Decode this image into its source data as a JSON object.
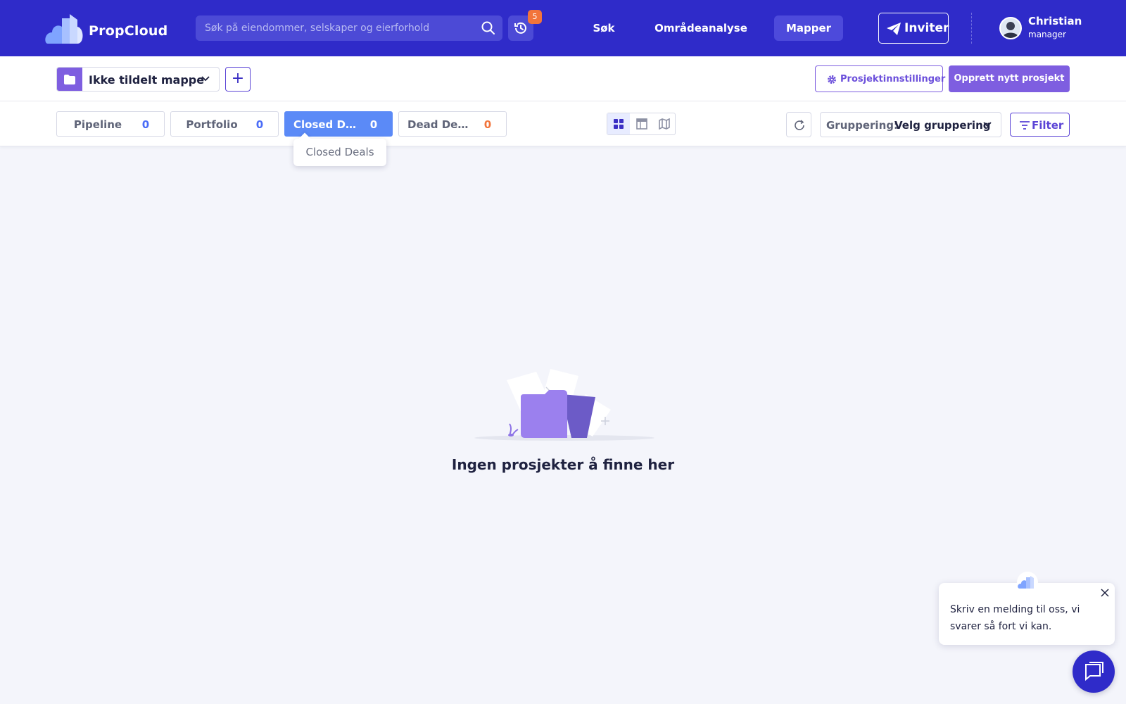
{
  "topnav": {
    "brand": "PropCloud",
    "search_placeholder": "Søk på eiendommer, selskaper og eierforhold",
    "history_badge": "5",
    "links": {
      "sok": "Søk",
      "omradeanalyse": "Områdeanalyse",
      "mapper": "Mapper"
    },
    "invite_label": "Inviter",
    "user": {
      "name": "Christian",
      "role": "manager"
    }
  },
  "toolbar": {
    "folder_label": "Ikke tildelt mappe",
    "add_label": "+",
    "settings_label": "Prosjektinnstillinger",
    "create_label": "Opprett nytt prosjekt"
  },
  "tabs": [
    {
      "label": "Pipeline",
      "count": "0"
    },
    {
      "label": "Portfolio",
      "count": "0"
    },
    {
      "label": "Closed Deals",
      "count": "0"
    },
    {
      "label": "Dead Deals",
      "count": "0"
    }
  ],
  "tooltip": "Closed Deals",
  "grouping": {
    "label": "Gruppering:",
    "value": "Velg gruppering"
  },
  "filter_label": "Filter",
  "empty": {
    "message": "Ingen prosjekter å finne her"
  },
  "chat": {
    "message": "Skriv en melding til oss, vi svarer så fort vi kan."
  },
  "colors": {
    "nav_bg": "#2f2bc9",
    "accent": "#7e5ee0",
    "active_tab": "#5b8af7",
    "badge": "#f2743b"
  }
}
